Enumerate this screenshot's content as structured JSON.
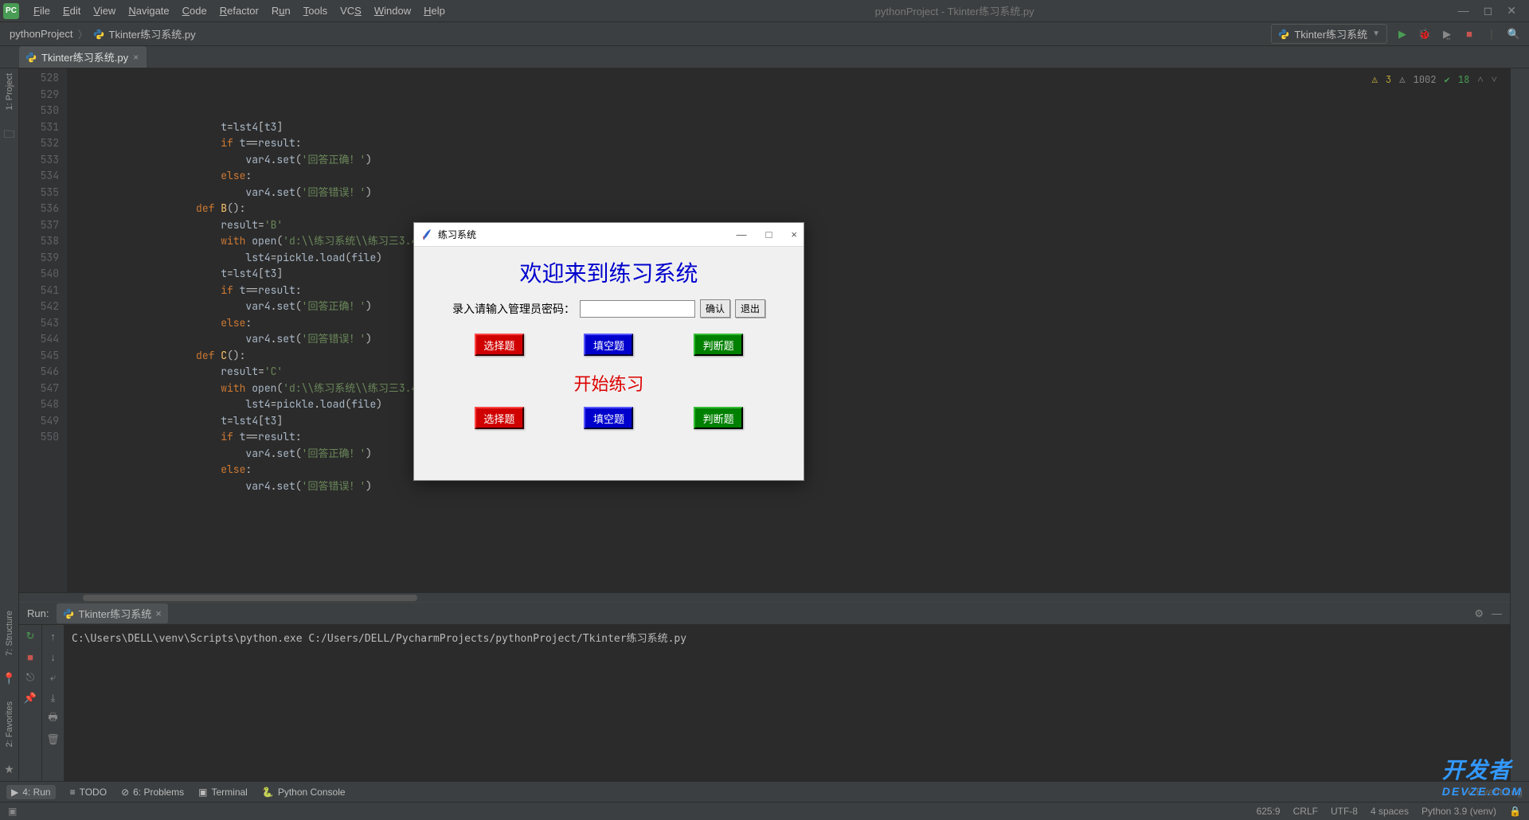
{
  "window": {
    "title": "pythonProject - Tkinter练习系统.py",
    "menu": [
      "File",
      "Edit",
      "View",
      "Navigate",
      "Code",
      "Refactor",
      "Run",
      "Tools",
      "VCS",
      "Window",
      "Help"
    ]
  },
  "breadcrumb": {
    "project": "pythonProject",
    "file": "Tkinter练习系统.py"
  },
  "run_config": {
    "name": "Tkinter练习系统"
  },
  "editor": {
    "tab": "Tkinter练习系统.py",
    "line_start": 528,
    "line_end": 550,
    "inspections": {
      "warn": "3",
      "weak": "1002",
      "typo": "18"
    },
    "code_lines": [
      "                        t=lst4[t3]",
      "                        if t==result:",
      "                            var4.set('回答正确！')",
      "                        else:",
      "                            var4.set('回答错误！')",
      "                    def B():",
      "                        result='B'",
      "                        with open('d:\\\\练习系统\\\\练习三3.4.pickle','rb') as file:",
      "                            lst4=pickle.load(file)",
      "                        t=lst4[t3]",
      "                        if t==result:",
      "                            var4.set('回答正确！')",
      "                        else:",
      "                            var4.set('回答错误！')",
      "                    def C():",
      "                        result='C'",
      "                        with open('d:\\\\练习系统\\\\练习三3.4.pickle','r",
      "                            lst4=pickle.load(file)",
      "                        t=lst4[t3]",
      "                        if t==result:",
      "                            var4.set('回答正确！')",
      "                        else:",
      "                            var4.set('回答错误！')"
    ]
  },
  "run_panel": {
    "title": "Run:",
    "tab": "Tkinter练习系统",
    "output": "C:\\Users\\DELL\\venv\\Scripts\\python.exe C:/Users/DELL/PycharmProjects/pythonProject/Tkinter练习系统.py"
  },
  "bottom_tabs": {
    "run": "4: Run",
    "todo": "TODO",
    "problems": "6: Problems",
    "terminal": "Terminal",
    "console": "Python Console"
  },
  "left_panel": {
    "project": "1: Project",
    "structure": "7: Structure",
    "favorites": "2: Favorites"
  },
  "status": {
    "pos": "625:9",
    "crlf": "CRLF",
    "encoding": "UTF-8",
    "indent": "4 spaces",
    "interpreter": "Python 3.9 (venv)"
  },
  "tk": {
    "title": "练习系统",
    "heading": "欢迎来到练习系统",
    "pw_label": "录入请输入管理员密码：",
    "ok": "确认",
    "exit": "退出",
    "choice": "选择题",
    "fill": "填空题",
    "judge": "判断题",
    "start": "开始练习"
  },
  "watermark": {
    "cn": "开发者",
    "en": "DEVZE.COM"
  }
}
